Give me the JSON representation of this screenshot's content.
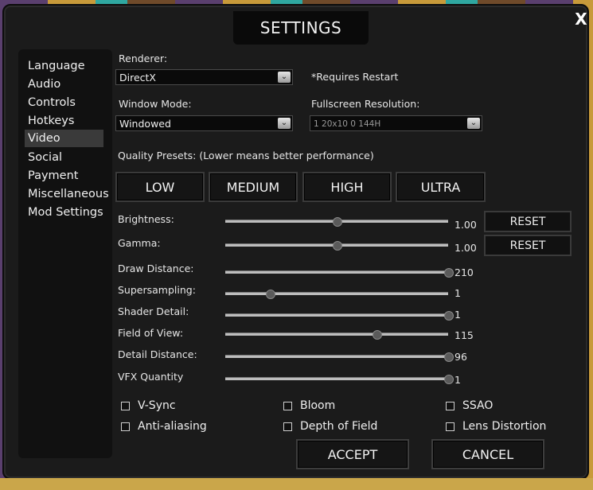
{
  "window": {
    "title": "SETTINGS",
    "close_label": "X"
  },
  "sidebar": {
    "items": [
      {
        "label": "Language"
      },
      {
        "label": "Audio"
      },
      {
        "label": "Controls"
      },
      {
        "label": "Hotkeys"
      },
      {
        "label": "Video",
        "active": true
      },
      {
        "label": "Social"
      },
      {
        "label": "Payment"
      },
      {
        "label": "Miscellaneous"
      },
      {
        "label": "Mod Settings"
      }
    ]
  },
  "video": {
    "renderer_label": "Renderer:",
    "renderer_value": "DirectX",
    "restart_note": "*Requires Restart",
    "window_mode_label": "Window Mode:",
    "window_mode_value": "Windowed",
    "fullscreen_label": "Fullscreen Resolution:",
    "fullscreen_value": "1 20x10 0  144H",
    "quality_label": "Quality Presets: (Lower means better performance)",
    "presets": [
      "LOW",
      "MEDIUM",
      "HIGH",
      "ULTRA"
    ],
    "sliders": [
      {
        "label": "Brightness:",
        "value": "1.00",
        "fraction": 0.5,
        "reset": "RESET"
      },
      {
        "label": "Gamma:",
        "value": "1.00",
        "fraction": 0.5,
        "reset": "RESET"
      },
      {
        "label": "Draw Distance:",
        "value": "210",
        "fraction": 1.0
      },
      {
        "label": "Supersampling:",
        "value": "1",
        "fraction": 0.2
      },
      {
        "label": "Shader Detail:",
        "value": "1",
        "fraction": 1.0
      },
      {
        "label": "Field of View:",
        "value": "115",
        "fraction": 0.68
      },
      {
        "label": "Detail Distance:",
        "value": "96",
        "fraction": 1.0
      },
      {
        "label": "VFX Quantity",
        "value": "1",
        "fraction": 1.0
      }
    ],
    "checkboxes": [
      {
        "label": "V-Sync",
        "checked": false
      },
      {
        "label": "Bloom",
        "checked": false
      },
      {
        "label": "SSAO",
        "checked": false
      },
      {
        "label": "Anti-aliasing",
        "checked": false
      },
      {
        "label": "Depth of Field",
        "checked": false
      },
      {
        "label": "Lens Distortion",
        "checked": false
      }
    ]
  },
  "footer": {
    "accept_label": "ACCEPT",
    "cancel_label": "CANCEL"
  },
  "icons": {
    "dropdown": "chevron-down-icon",
    "close": "close-icon"
  }
}
